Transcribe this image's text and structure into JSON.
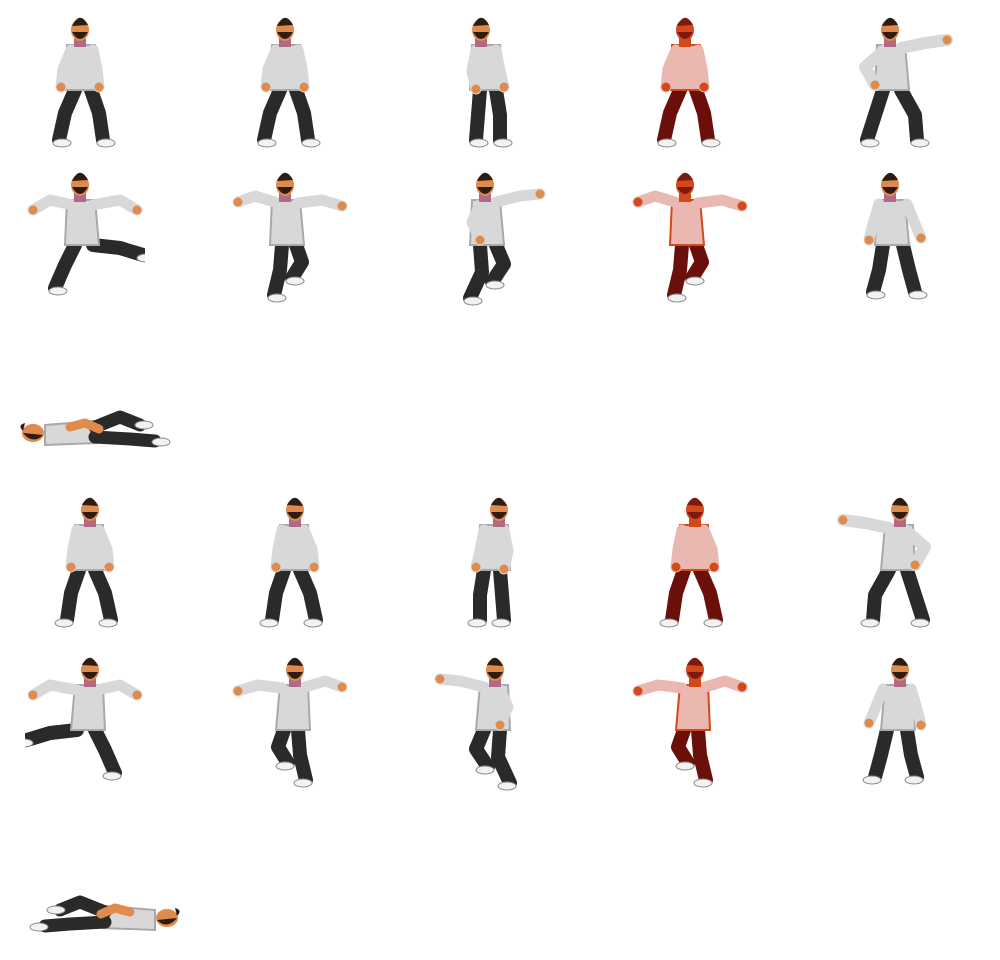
{
  "sheet": {
    "background": "#ffffff",
    "palette": {
      "shirt": "#d8d8d8",
      "shirt_shade": "#a9a9a9",
      "pants": "#2a2a2a",
      "skin": "#e08a4c",
      "hair": "#2b1d14",
      "shoes": "#f2f2ee",
      "scarf": "#b06a86",
      "hit_shirt": "#e9b8b0",
      "hit_pants": "#6a0f0a",
      "hit_skin": "#d24a1c",
      "hit_hair": "#7a1a10"
    },
    "rows": [
      {
        "facing": "right",
        "frames": [
          {
            "pose": "idle"
          },
          {
            "pose": "idle"
          },
          {
            "pose": "idle-turn"
          },
          {
            "pose": "idle",
            "tint": "hit"
          },
          {
            "pose": "punch-extend"
          }
        ]
      },
      {
        "facing": "right",
        "frames": [
          {
            "pose": "kick-wide"
          },
          {
            "pose": "jump-arms-out"
          },
          {
            "pose": "jump-punch"
          },
          {
            "pose": "jump-arms-out",
            "tint": "hit"
          },
          {
            "pose": "front-stand"
          }
        ]
      },
      {
        "facing": "right",
        "frames": [
          {
            "pose": "knocked-down"
          }
        ]
      },
      {
        "facing": "left",
        "frames": [
          {
            "pose": "idle"
          },
          {
            "pose": "idle"
          },
          {
            "pose": "idle-turn"
          },
          {
            "pose": "idle",
            "tint": "hit"
          },
          {
            "pose": "punch-extend"
          }
        ]
      },
      {
        "facing": "left",
        "frames": [
          {
            "pose": "kick-wide"
          },
          {
            "pose": "jump-arms-out"
          },
          {
            "pose": "jump-punch"
          },
          {
            "pose": "jump-arms-out",
            "tint": "hit"
          },
          {
            "pose": "front-stand"
          }
        ]
      },
      {
        "facing": "left",
        "frames": [
          {
            "pose": "knocked-down"
          }
        ]
      }
    ]
  }
}
